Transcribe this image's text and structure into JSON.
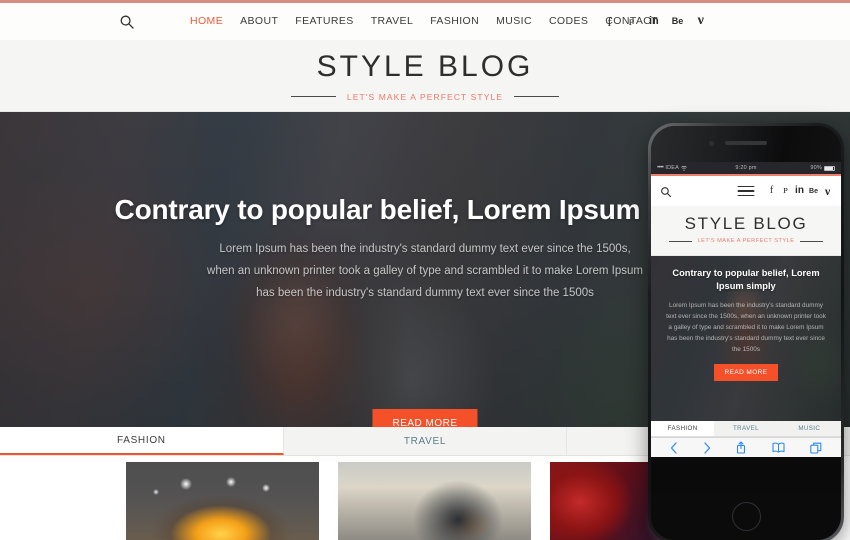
{
  "theme": {
    "accent_top": "#d98c82",
    "brand_orange": "#f4502a",
    "tagline_color": "#ef7a68",
    "tab_link_color": "#5b7d8c"
  },
  "header": {
    "search_icon": "search-icon",
    "nav_items": [
      {
        "label": "HOME",
        "active": true
      },
      {
        "label": "ABOUT",
        "active": false
      },
      {
        "label": "FEATURES",
        "active": false
      },
      {
        "label": "TRAVEL",
        "active": false
      },
      {
        "label": "FASHION",
        "active": false
      },
      {
        "label": "MUSIC",
        "active": false
      },
      {
        "label": "CODES",
        "active": false
      },
      {
        "label": "CONTACT",
        "active": false
      }
    ],
    "social": [
      {
        "name": "facebook-icon",
        "glyph": "f"
      },
      {
        "name": "pinterest-icon",
        "glyph": "ᴘ"
      },
      {
        "name": "linkedin-icon",
        "glyph": "in"
      },
      {
        "name": "behance-icon",
        "glyph": "Be"
      },
      {
        "name": "vimeo-icon",
        "glyph": "ν"
      }
    ]
  },
  "branding": {
    "title": "STYLE BLOG",
    "tagline": "LET'S MAKE A PERFECT STYLE"
  },
  "hero": {
    "title": "Contrary to popular belief, Lorem Ipsum simply",
    "paragraph": "Lorem Ipsum has been the industry's standard dummy text ever since the 1500s, when an unknown printer took a galley of type and scrambled it to make Lorem Ipsum has been the industry's standard dummy text ever since the 1500s",
    "button_label": "READ MORE"
  },
  "tabs": [
    {
      "label": "FASHION",
      "active": true
    },
    {
      "label": "TRAVEL",
      "active": false
    },
    {
      "label": "MUSIC",
      "active": false
    }
  ],
  "cards": [
    {
      "name": "card-concert-stage"
    },
    {
      "name": "card-street-guitarist"
    },
    {
      "name": "card-red-lit-venue"
    }
  ],
  "phone": {
    "status_bar": {
      "signal_dots": "••••",
      "carrier": "IDEA",
      "wifi": "wifi-icon",
      "time": "9:20 pm",
      "battery_percent": "90%"
    },
    "nav": {
      "search_icon": "search-icon",
      "menu_icon": "hamburger-menu-icon",
      "social": [
        {
          "name": "facebook-icon",
          "glyph": "f"
        },
        {
          "name": "pinterest-icon",
          "glyph": "ᴘ"
        },
        {
          "name": "linkedin-icon",
          "glyph": "in"
        },
        {
          "name": "behance-icon",
          "glyph": "Be"
        },
        {
          "name": "vimeo-icon",
          "glyph": "ν"
        }
      ]
    },
    "branding": {
      "title": "STYLE BLOG",
      "tagline": "LET'S MAKE A PERFECT STYLE"
    },
    "hero": {
      "title": "Contrary to popular belief, Lorem Ipsum simply",
      "paragraph": "Lorem Ipsum has been the industry's standard dummy text ever since the 1500s, when an unknown printer took a galley of type and scrambled it to make Lorem Ipsum has been the industry's standard dummy text ever since the 1500s",
      "button_label": "READ MORE"
    },
    "tabs": [
      {
        "label": "FASHION",
        "active": true
      },
      {
        "label": "TRAVEL",
        "active": false
      },
      {
        "label": "MUSIC",
        "active": false
      }
    ],
    "toolbar": [
      {
        "name": "back-icon"
      },
      {
        "name": "forward-icon"
      },
      {
        "name": "share-icon"
      },
      {
        "name": "bookmarks-icon"
      },
      {
        "name": "tabs-icon"
      }
    ],
    "home_button": "home-button"
  }
}
